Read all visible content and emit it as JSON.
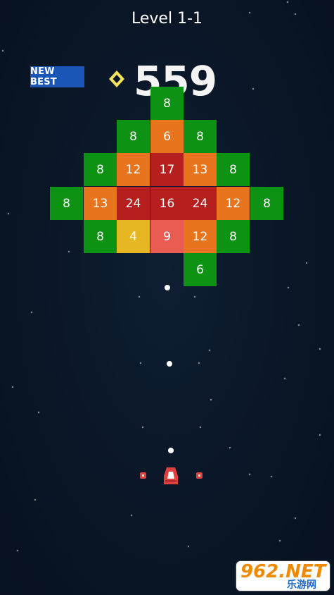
{
  "header": {
    "level_title": "Level 1-1",
    "new_best_label": "NEW BEST",
    "score": "559"
  },
  "colors": {
    "green": "#0e9213",
    "orange": "#e8751d",
    "dark_red": "#b5201f",
    "yellow": "#e6b722",
    "coral": "#e85c51",
    "ship_red": "#e04040"
  },
  "blocks": [
    {
      "value": "8",
      "color": "green"
    },
    {
      "value": "8",
      "color": "green"
    },
    {
      "value": "6",
      "color": "orange"
    },
    {
      "value": "8",
      "color": "green"
    },
    {
      "value": "8",
      "color": "green"
    },
    {
      "value": "12",
      "color": "orange"
    },
    {
      "value": "17",
      "color": "dark_red"
    },
    {
      "value": "13",
      "color": "orange"
    },
    {
      "value": "8",
      "color": "green"
    },
    {
      "value": "8",
      "color": "green"
    },
    {
      "value": "13",
      "color": "orange"
    },
    {
      "value": "24",
      "color": "dark_red"
    },
    {
      "value": "16",
      "color": "dark_red"
    },
    {
      "value": "24",
      "color": "dark_red"
    },
    {
      "value": "12",
      "color": "orange"
    },
    {
      "value": "8",
      "color": "green"
    },
    {
      "value": "8",
      "color": "green"
    },
    {
      "value": "4",
      "color": "yellow"
    },
    {
      "value": "9",
      "color": "coral"
    },
    {
      "value": "12",
      "color": "orange"
    },
    {
      "value": "8",
      "color": "green"
    },
    {
      "value": "6",
      "color": "green"
    }
  ],
  "watermark": {
    "brand": "962.NET",
    "sub": "乐游网"
  }
}
